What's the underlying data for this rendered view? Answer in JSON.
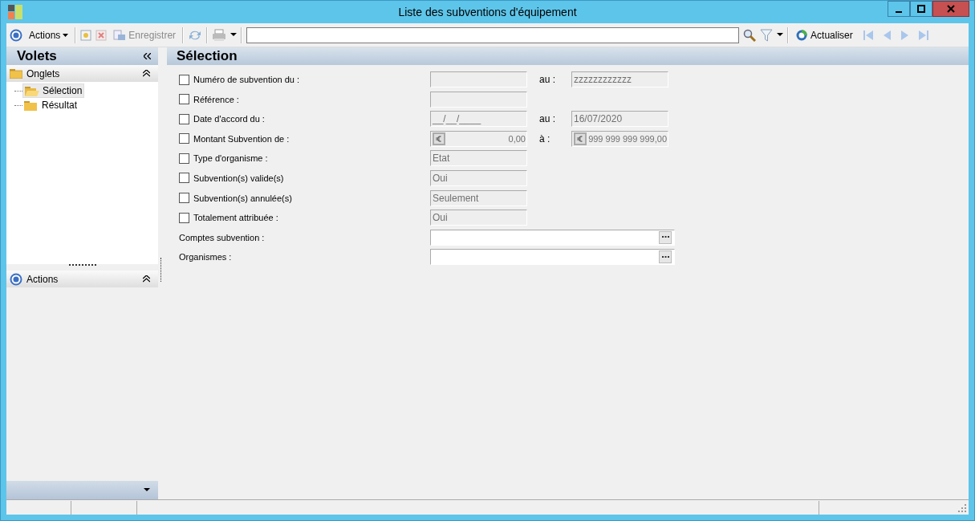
{
  "window": {
    "title": "Liste des subventions d'équipement"
  },
  "toolbar": {
    "actions_menu": "Actions",
    "save": {
      "label": "Enregistrer",
      "disabled": true
    },
    "refresh": "Actualiser",
    "nav_disabled": true
  },
  "sidebar": {
    "title": "Volets",
    "groups": [
      {
        "kind": "tabs",
        "label": "Onglets",
        "expanded": true,
        "items": [
          {
            "label": "Sélection",
            "selected": true
          },
          {
            "label": "Résultat",
            "selected": false
          }
        ]
      },
      {
        "kind": "actions",
        "label": "Actions",
        "expanded": true
      }
    ]
  },
  "panel": {
    "title": "Sélection"
  },
  "rows": [
    {
      "kind": "check",
      "label": "Numéro de subvention du :",
      "checked": false,
      "from": {
        "disabled": true
      },
      "to_label": "au :",
      "to": {
        "value": "zzzzzzzzzzzz",
        "disabled": true
      }
    },
    {
      "kind": "check",
      "label": "Référence :",
      "checked": false,
      "from": {
        "disabled": true
      }
    },
    {
      "kind": "check",
      "label": "Date d'accord du :",
      "checked": false,
      "from": {
        "value": "__/__/____",
        "disabled": true
      },
      "to_label": "au :",
      "to": {
        "value": "16/07/2020",
        "disabled": true
      }
    },
    {
      "kind": "check",
      "label": "Montant Subvention de :",
      "checked": false,
      "from": {
        "value": "0,00",
        "disabled": true,
        "currency": true
      },
      "to_label": "à :",
      "to": {
        "value": "999 999 999 999,00",
        "disabled": true,
        "currency": true
      }
    },
    {
      "kind": "check",
      "label": "Type d'organisme :",
      "checked": false,
      "from": {
        "value": "Etat",
        "disabled": true
      }
    },
    {
      "kind": "check",
      "label": "Subvention(s) valide(s)",
      "checked": false,
      "from": {
        "value": "Oui",
        "disabled": true
      }
    },
    {
      "kind": "check",
      "label": "Subvention(s) annulée(s)",
      "checked": false,
      "from": {
        "value": "Seulement",
        "disabled": true
      }
    },
    {
      "kind": "check",
      "label": "Totalement attribuée :",
      "checked": false,
      "from": {
        "value": "Oui",
        "disabled": true
      }
    },
    {
      "kind": "lookup",
      "label": "Comptes subvention :",
      "from": {
        "disabled": false
      }
    },
    {
      "kind": "lookup",
      "label": "Organismes :",
      "from": {
        "disabled": false
      }
    }
  ]
}
